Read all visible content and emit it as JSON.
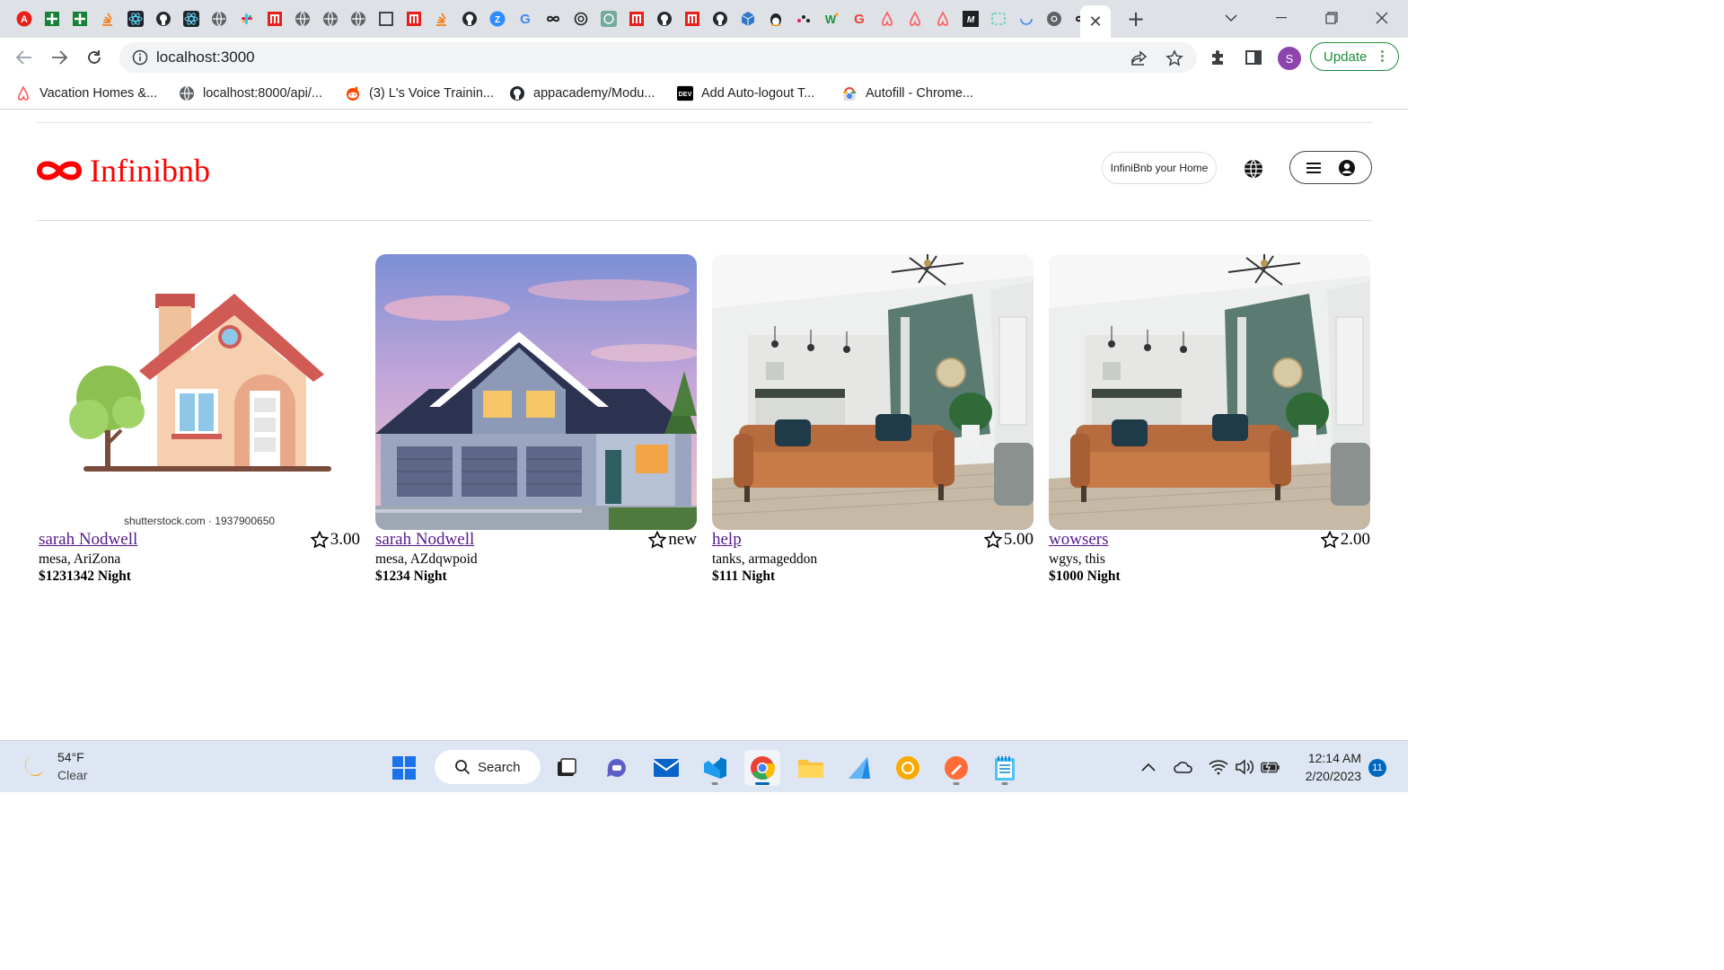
{
  "browser": {
    "url": "localhost:3000",
    "update_label": "Update",
    "profile_initial": "S",
    "close_tab_glyph": "✕",
    "new_tab_glyph": "+"
  },
  "bookmarks": [
    {
      "label": "Vacation Homes &...",
      "icon": "airbnb-icon"
    },
    {
      "label": "localhost:8000/api/...",
      "icon": "globe-icon"
    },
    {
      "label": "(3) L's Voice Trainin...",
      "icon": "reddit-icon"
    },
    {
      "label": "appacademy/Modu...",
      "icon": "github-icon"
    },
    {
      "label": "Add Auto-logout T...",
      "icon": "dev-icon"
    },
    {
      "label": "Autofill - Chrome...",
      "icon": "chrome-webstore-icon"
    }
  ],
  "site": {
    "logo_text": "Infinibnb",
    "host_button": "InfiniBnb your Home",
    "accent_color": "#ff0000"
  },
  "listings": [
    {
      "title": "sarah Nodwell",
      "rating": "3.00",
      "location": "mesa, AriZona",
      "price": "$1231342 Night",
      "image": "cartoon-house",
      "image_caption": "shutterstock.com · 1937900650"
    },
    {
      "title": "sarah Nodwell",
      "rating": "new",
      "location": "mesa, AZdqwpoid",
      "price": "$1234 Night",
      "image": "blue-house-photo"
    },
    {
      "title": "help",
      "rating": "5.00",
      "location": "tanks, armageddon",
      "price": "$111 Night",
      "image": "living-room-photo"
    },
    {
      "title": "wowsers",
      "rating": "2.00",
      "location": "wgys, this",
      "price": "$1000 Night",
      "image": "living-room-photo"
    }
  ],
  "taskbar": {
    "weather_temp": "54°F",
    "weather_desc": "Clear",
    "search_label": "Search",
    "time": "12:14 AM",
    "date": "2/20/2023",
    "notification_count": "11"
  }
}
